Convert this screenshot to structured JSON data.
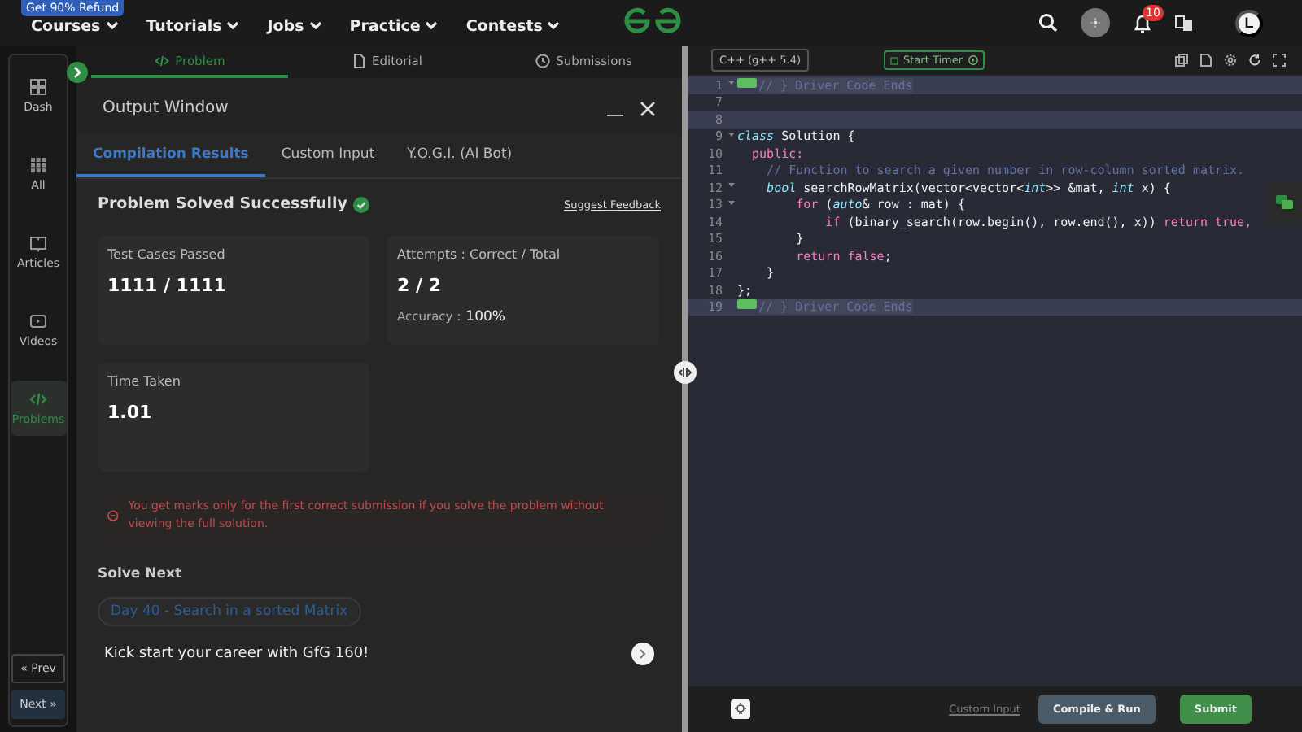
{
  "nav": {
    "promo_badge": "Get 90% Refund",
    "menu": [
      {
        "label": "Courses"
      },
      {
        "label": "Tutorials"
      },
      {
        "label": "Jobs"
      },
      {
        "label": "Practice"
      },
      {
        "label": "Contests"
      }
    ],
    "notification_count": "10",
    "avatar_initial": "L"
  },
  "sidebar": {
    "items": [
      {
        "label": "Dash",
        "selected": false
      },
      {
        "label": "All",
        "selected": false
      },
      {
        "label": "Articles",
        "selected": false
      },
      {
        "label": "Videos",
        "selected": false
      },
      {
        "label": "Problems",
        "selected": true
      }
    ],
    "prev": "« Prev",
    "next": "Next »"
  },
  "problem_tabs": [
    {
      "label": "Problem",
      "selected": true
    },
    {
      "label": "Editorial",
      "selected": false
    },
    {
      "label": "Submissions",
      "selected": false
    }
  ],
  "output_window": {
    "title": "Output Window",
    "tabs": [
      {
        "label": "Compilation Results",
        "selected": true
      },
      {
        "label": "Custom Input",
        "selected": false
      },
      {
        "label": "Y.O.G.I. (AI Bot)",
        "selected": false
      }
    ],
    "status": "Problem Solved Successfully",
    "feedback_link": "Suggest Feedback",
    "cards": [
      {
        "label": "Test Cases Passed",
        "value": "1111 / 1111"
      },
      {
        "label": "Attempts : Correct / Total",
        "value": "2 / 2",
        "sub_label": "Accuracy :",
        "sub_value": "100%"
      },
      {
        "label": "Time Taken",
        "value": "1.01"
      }
    ],
    "notice": "You get marks only for the first correct submission if you solve the problem without viewing the full solution.",
    "solve_next_heading": "Solve Next",
    "next_problem": "Day 40 - Search in a sorted Matrix",
    "promo": "Kick start your career with GfG 160!"
  },
  "editor": {
    "language": "C++ (g++ 5.4)",
    "timer_button": "Start Timer",
    "lines": [
      {
        "num": "1",
        "fold": true,
        "active": false,
        "tokens": [
          {
            "kind": "marker"
          },
          {
            "kind": "selected",
            "text": "// } Driver Code Ends"
          }
        ]
      },
      {
        "num": "7",
        "fold": false,
        "active": false
      },
      {
        "num": "8",
        "fold": false,
        "active": true
      },
      {
        "num": "9",
        "fold": true,
        "active": false,
        "tokens": [
          {
            "kind": "keyword-italic",
            "text": "class"
          },
          {
            "kind": "plain",
            "text": " Solution {"
          }
        ]
      },
      {
        "num": "10",
        "fold": false,
        "active": false,
        "tokens": [
          {
            "kind": "keyword",
            "text": "  public:"
          }
        ]
      },
      {
        "num": "11",
        "fold": false,
        "active": false,
        "tokens": [
          {
            "kind": "comment",
            "text": "    // Function to search a given number in row-column sorted matrix."
          }
        ]
      },
      {
        "num": "12",
        "fold": true,
        "active": false,
        "tokens": [
          {
            "kind": "type",
            "text": "    bool"
          },
          {
            "kind": "plain",
            "text": " searchRowMatrix(vector<vector<"
          },
          {
            "kind": "type",
            "text": "int"
          },
          {
            "kind": "plain",
            "text": ">> &mat, "
          },
          {
            "kind": "type",
            "text": "int"
          },
          {
            "kind": "plain",
            "text": " x) {"
          }
        ]
      },
      {
        "num": "13",
        "fold": true,
        "active": false,
        "tokens": [
          {
            "kind": "keyword",
            "text": "        for"
          },
          {
            "kind": "plain",
            "text": " ("
          },
          {
            "kind": "type",
            "text": "auto"
          },
          {
            "kind": "plain",
            "text": "& row : mat) {"
          }
        ]
      },
      {
        "num": "14",
        "fold": false,
        "active": false,
        "tokens": [
          {
            "kind": "keyword",
            "text": "            if"
          },
          {
            "kind": "plain",
            "text": " (binary_search(row.begin(), row.end(), x)) "
          },
          {
            "kind": "keyword",
            "text": "return true,"
          }
        ]
      },
      {
        "num": "15",
        "fold": false,
        "active": false,
        "tokens": [
          {
            "kind": "plain",
            "text": "        }"
          }
        ]
      },
      {
        "num": "16",
        "fold": false,
        "active": false,
        "tokens": [
          {
            "kind": "keyword",
            "text": "        return false"
          },
          {
            "kind": "plain",
            "text": ";"
          }
        ]
      },
      {
        "num": "17",
        "fold": false,
        "active": false,
        "tokens": [
          {
            "kind": "plain",
            "text": "    }"
          }
        ]
      },
      {
        "num": "18",
        "fold": false,
        "active": false,
        "tokens": [
          {
            "kind": "plain",
            "text": "};"
          }
        ]
      },
      {
        "num": "19",
        "fold": false,
        "active": false,
        "tokens": [
          {
            "kind": "marker"
          },
          {
            "kind": "selected",
            "text": "// } Driver Code Ends"
          }
        ]
      }
    ],
    "custom_input_link": "Custom Input",
    "compile_button": "Compile & Run",
    "submit_button": "Submit"
  }
}
